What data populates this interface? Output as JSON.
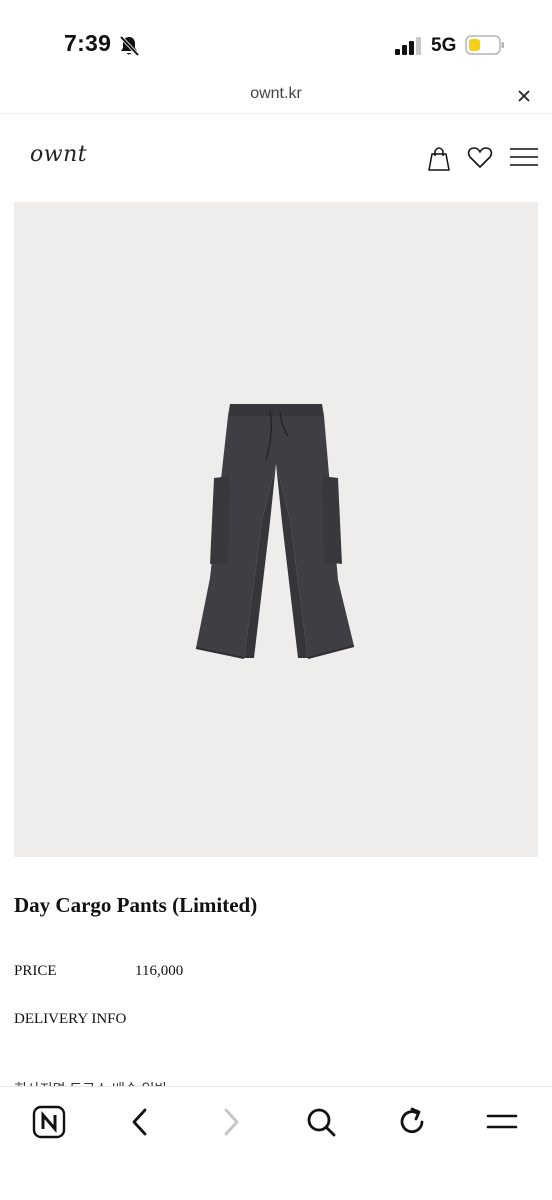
{
  "status_bar": {
    "time": "7:39",
    "network": "5G"
  },
  "browser": {
    "url": "ownt.kr"
  },
  "site": {
    "logo": "ownt"
  },
  "product": {
    "title": "Day Cargo Pants (Limited)",
    "price_label": "PRICE",
    "price_value": "116,000",
    "delivery_label": "DELIVERY INFO",
    "cutoff_text": "회사지명        드로스 배송 일반"
  },
  "colors": {
    "image_background": "#efedec",
    "pants": "#3d3d42",
    "battery_fill": "#f5cf1a"
  },
  "icons": [
    "bell-slash-icon",
    "signal-icon",
    "battery-icon",
    "close-icon",
    "shopping-bag-icon",
    "heart-icon",
    "hamburger-menu-icon",
    "naver-n-icon",
    "back-arrow-icon",
    "forward-arrow-icon",
    "search-icon",
    "reload-icon",
    "menu-icon"
  ]
}
